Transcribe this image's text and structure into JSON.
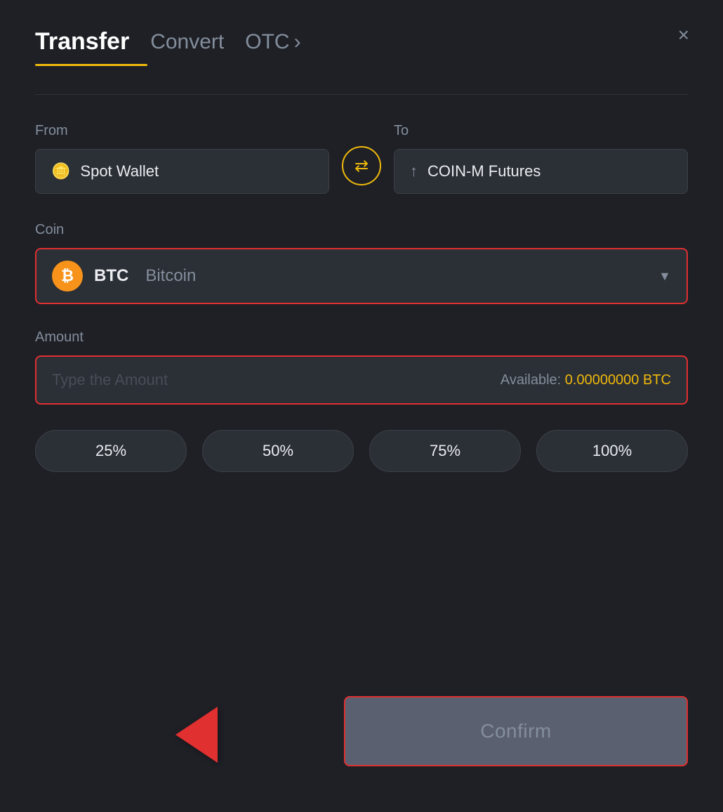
{
  "header": {
    "title": "Transfer",
    "tab_convert": "Convert",
    "tab_otc": "OTC",
    "tab_otc_chevron": "›",
    "close_label": "×"
  },
  "from_section": {
    "label": "From",
    "wallet_name": "Spot Wallet",
    "wallet_icon": "💳"
  },
  "swap": {
    "icon": "⇆"
  },
  "to_section": {
    "label": "To",
    "wallet_name": "COIN-M Futures",
    "wallet_icon": "↑"
  },
  "coin_section": {
    "label": "Coin",
    "coin_symbol": "BTC",
    "coin_name": "Bitcoin",
    "coin_icon_letter": "₿"
  },
  "amount_section": {
    "label": "Amount",
    "placeholder": "Type the Amount",
    "available_label": "Available:",
    "available_amount": "0.00000000 BTC"
  },
  "percentage_buttons": [
    {
      "label": "25%"
    },
    {
      "label": "50%"
    },
    {
      "label": "75%"
    },
    {
      "label": "100%"
    }
  ],
  "confirm_button": {
    "label": "Confirm"
  },
  "colors": {
    "accent": "#f0b90b",
    "danger": "#e03030",
    "bg": "#1e2026",
    "surface": "#2b2f36",
    "text_primary": "#eaecef",
    "text_muted": "#848e9c"
  }
}
